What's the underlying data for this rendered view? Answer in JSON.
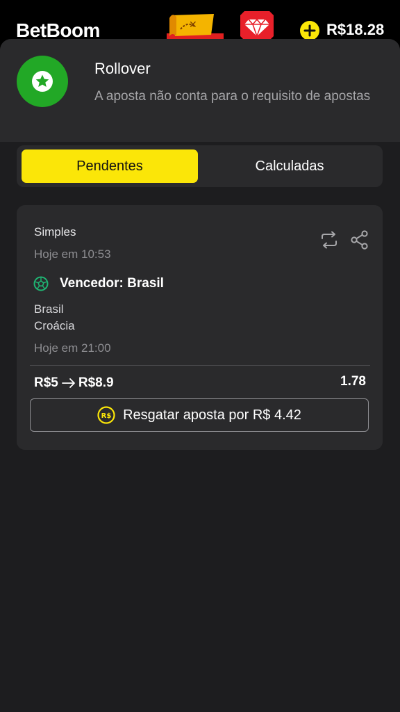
{
  "header": {
    "logo": "BetBoom",
    "balance": "R$18.28",
    "icons": [
      "treasure-map-icon",
      "gem-icon",
      "plus-icon"
    ]
  },
  "notice": {
    "title": "Rollover",
    "description": "A aposta não conta para o requisito de apostas",
    "icon": "star-icon"
  },
  "tabs": [
    {
      "label": "Pendentes",
      "active": true
    },
    {
      "label": "Calculadas",
      "active": false
    }
  ],
  "bet": {
    "type": "Simples",
    "placed_at": "Hoje em 10:53",
    "market": "Vencedor: Brasil",
    "team1": "Brasil",
    "team2": "Croácia",
    "event_time": "Hoje em 21:00",
    "stake": "R$5",
    "potential_win": "R$8.9",
    "odds": "1.78",
    "cashout_label": "Resgatar aposta por R$ 4.42"
  },
  "colors": {
    "accent": "#fbe608",
    "success": "#22a826",
    "sport_icon": "#1fb573",
    "background": "#1d1d1f",
    "card": "#2a2a2c"
  }
}
